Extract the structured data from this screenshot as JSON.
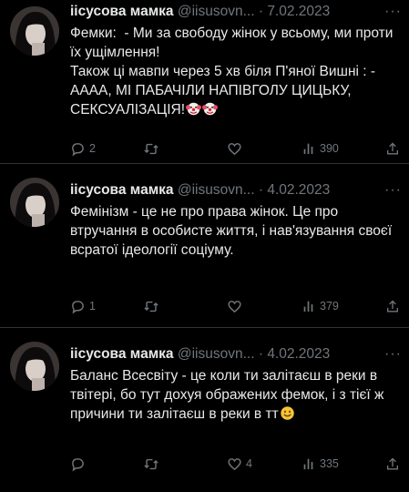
{
  "tweets": [
    {
      "name": "іісусова мамка",
      "handle": "@iisusovn...",
      "dot": "·",
      "date": "7.02.2023",
      "text": "Фемки:  - Ми за свободу жінок у всьому, ми проти їх ущімлення!\nТакож ці мавпи через 5 хв біля П'яної Вишні : - АААА, МІ ПАБАЧІЛИ НАПІВГОЛУ ЦИЦЬКУ, СЕКСУАЛІЗАЦІЯ!",
      "emoji": [
        "clown-face-icon",
        "clown-face-icon"
      ],
      "replies": "2",
      "retweets": "",
      "likes": "",
      "views": "390"
    },
    {
      "name": "іісусова мамка",
      "handle": "@iisusovn...",
      "dot": "·",
      "date": "4.02.2023",
      "text": "Фемінізм - це не про права жінок. Це про втручання в особисте життя, і нав'язування своєї всратої ідеології соціуму.",
      "emoji": [],
      "replies": "1",
      "retweets": "",
      "likes": "",
      "views": "379"
    },
    {
      "name": "іісусова мамка",
      "handle": "@iisusovn...",
      "dot": "·",
      "date": "4.02.2023",
      "text": "Баланс Всесвіту - це коли ти залітаєш в реки в твітері, бо тут дохуя ображених фемок, і з тієї ж причини ти залітаєш в реки в тт",
      "emoji": [
        "smiling-face-icon"
      ],
      "replies": "",
      "retweets": "",
      "likes": "4",
      "views": "335"
    }
  ],
  "more_label": "···",
  "icons": {
    "reply": "reply-icon",
    "retweet": "retweet-icon",
    "like": "heart-icon",
    "views": "views-bar-chart-icon",
    "share": "share-icon",
    "more": "more-dots-icon"
  },
  "colors": {
    "background": "#000000",
    "text": "#e7e9ea",
    "muted": "#71767b",
    "divider": "#2f3336"
  }
}
